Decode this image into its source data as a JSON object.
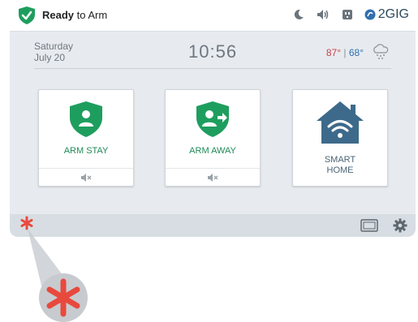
{
  "status": {
    "ready_bold": "Ready",
    "ready_rest": " to Arm",
    "brand": "2GIG",
    "icons": [
      "moon-icon",
      "volume-icon",
      "outlet-icon"
    ],
    "accent_color": "#1e9e5e"
  },
  "datetime": {
    "day": "Saturday",
    "date": "July 20",
    "time": "10:56"
  },
  "weather": {
    "high": "87°",
    "separator": "|",
    "low": "68°",
    "icon": "snow-cloud-icon"
  },
  "tiles": [
    {
      "label": "ARM STAY",
      "icon": "shield-person-icon",
      "foot_icon": "speaker-mute-icon"
    },
    {
      "label": "ARM AWAY",
      "icon": "shield-person-exit-icon",
      "foot_icon": "speaker-mute-icon"
    },
    {
      "label_line1": "SMART",
      "label_line2": "HOME",
      "icon": "home-wifi-icon"
    }
  ],
  "bottombar": {
    "emergency_icon": "asterisk-icon",
    "icons": [
      "screen-icon",
      "gear-icon"
    ],
    "emergency_color": "#e8493d"
  }
}
